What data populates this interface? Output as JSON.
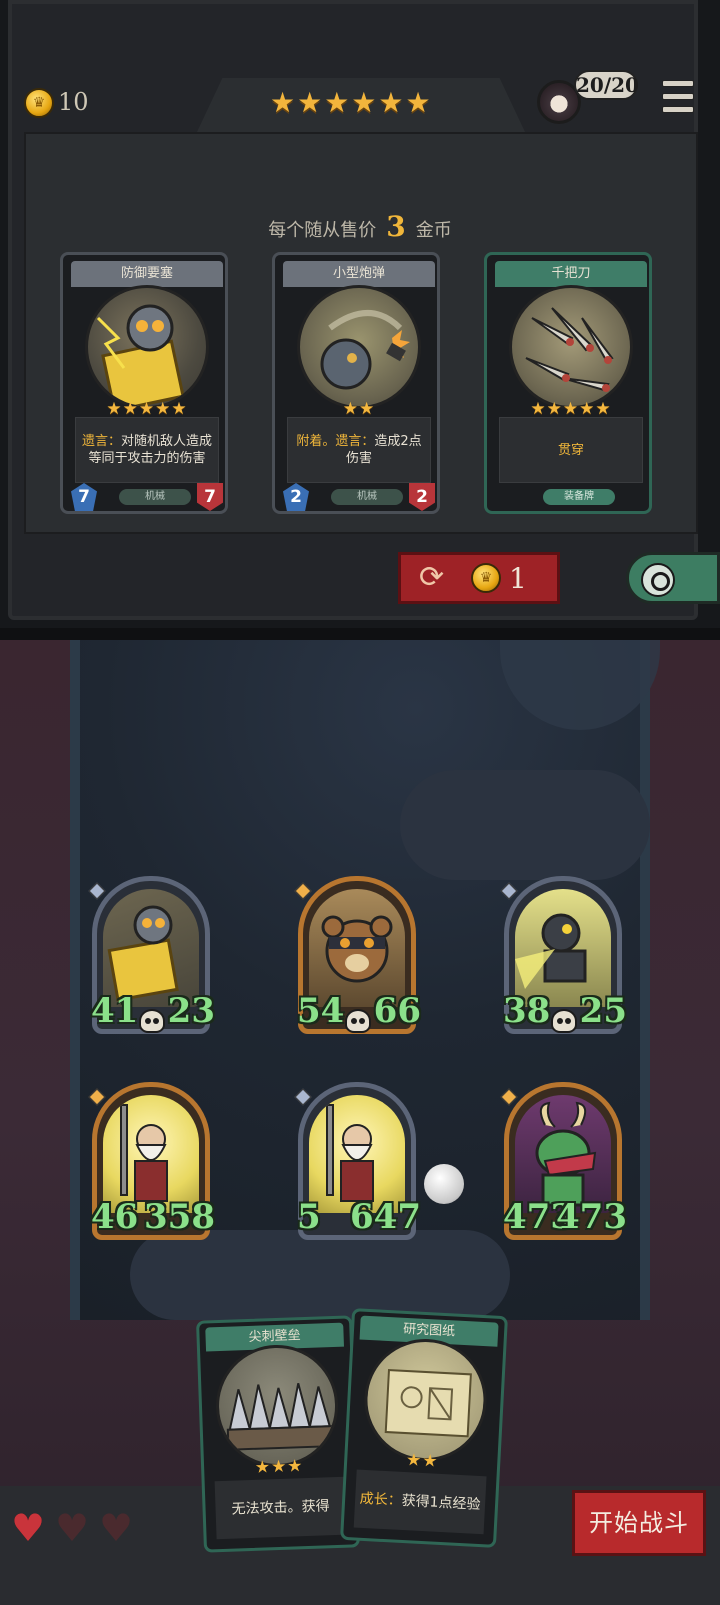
{
  "header": {
    "gold": "10",
    "tier_stars": "★★★★★★",
    "level_text": "20/20",
    "icons": {
      "gold": "crown-coin-icon",
      "menu": "hamburger-menu-icon",
      "avatar": "player-avatar"
    }
  },
  "shop": {
    "price_prefix": "每个随从售价",
    "price_value": "3",
    "price_suffix": "金币",
    "cards": [
      {
        "name": "防御要塞",
        "stars": "★★★★★",
        "keyword": "遗言：",
        "text": "对随机敌人造成等同于攻击力的伤害",
        "tag": "机械",
        "attack": "7",
        "health": "7",
        "color": "gray"
      },
      {
        "name": "小型炮弹",
        "stars": "★★",
        "keyword": "附着。遗言：",
        "text": "造成2点伤害",
        "tag": "机械",
        "attack": "2",
        "health": "2",
        "color": "gray"
      },
      {
        "name": "千把刀",
        "stars": "★★★★★",
        "keyword": "",
        "text": "贯穿",
        "tag": "装备牌",
        "attack": "",
        "health": "",
        "color": "green"
      }
    ],
    "refresh_cost": "1"
  },
  "board": {
    "minions": [
      {
        "attack": "41",
        "health": "23",
        "frame": "silver"
      },
      {
        "attack": "54",
        "health": "66",
        "frame": "gold"
      },
      {
        "attack": "38",
        "health": "25",
        "frame": "silver"
      },
      {
        "attack": "46",
        "health": "358",
        "frame": "gold"
      },
      {
        "attack": "5",
        "health": "647",
        "frame": "silver"
      },
      {
        "attack": "473",
        "health": "473",
        "frame": "gold"
      }
    ]
  },
  "hand": [
    {
      "name": "尖刺壁垒",
      "stars": "★★★",
      "keyword": "",
      "text": "无法攻击。获得"
    },
    {
      "name": "研究图纸",
      "stars": "★★",
      "keyword": "成长：",
      "text": "获得1点经验"
    }
  ],
  "lives": {
    "total": 3,
    "remaining": 1
  },
  "start_button": "开始战斗",
  "colors": {
    "accent_gold": "#f0b63a",
    "button_red": "#b82a2c",
    "card_green": "#3f7d68",
    "stat_green": "#8be08a"
  }
}
